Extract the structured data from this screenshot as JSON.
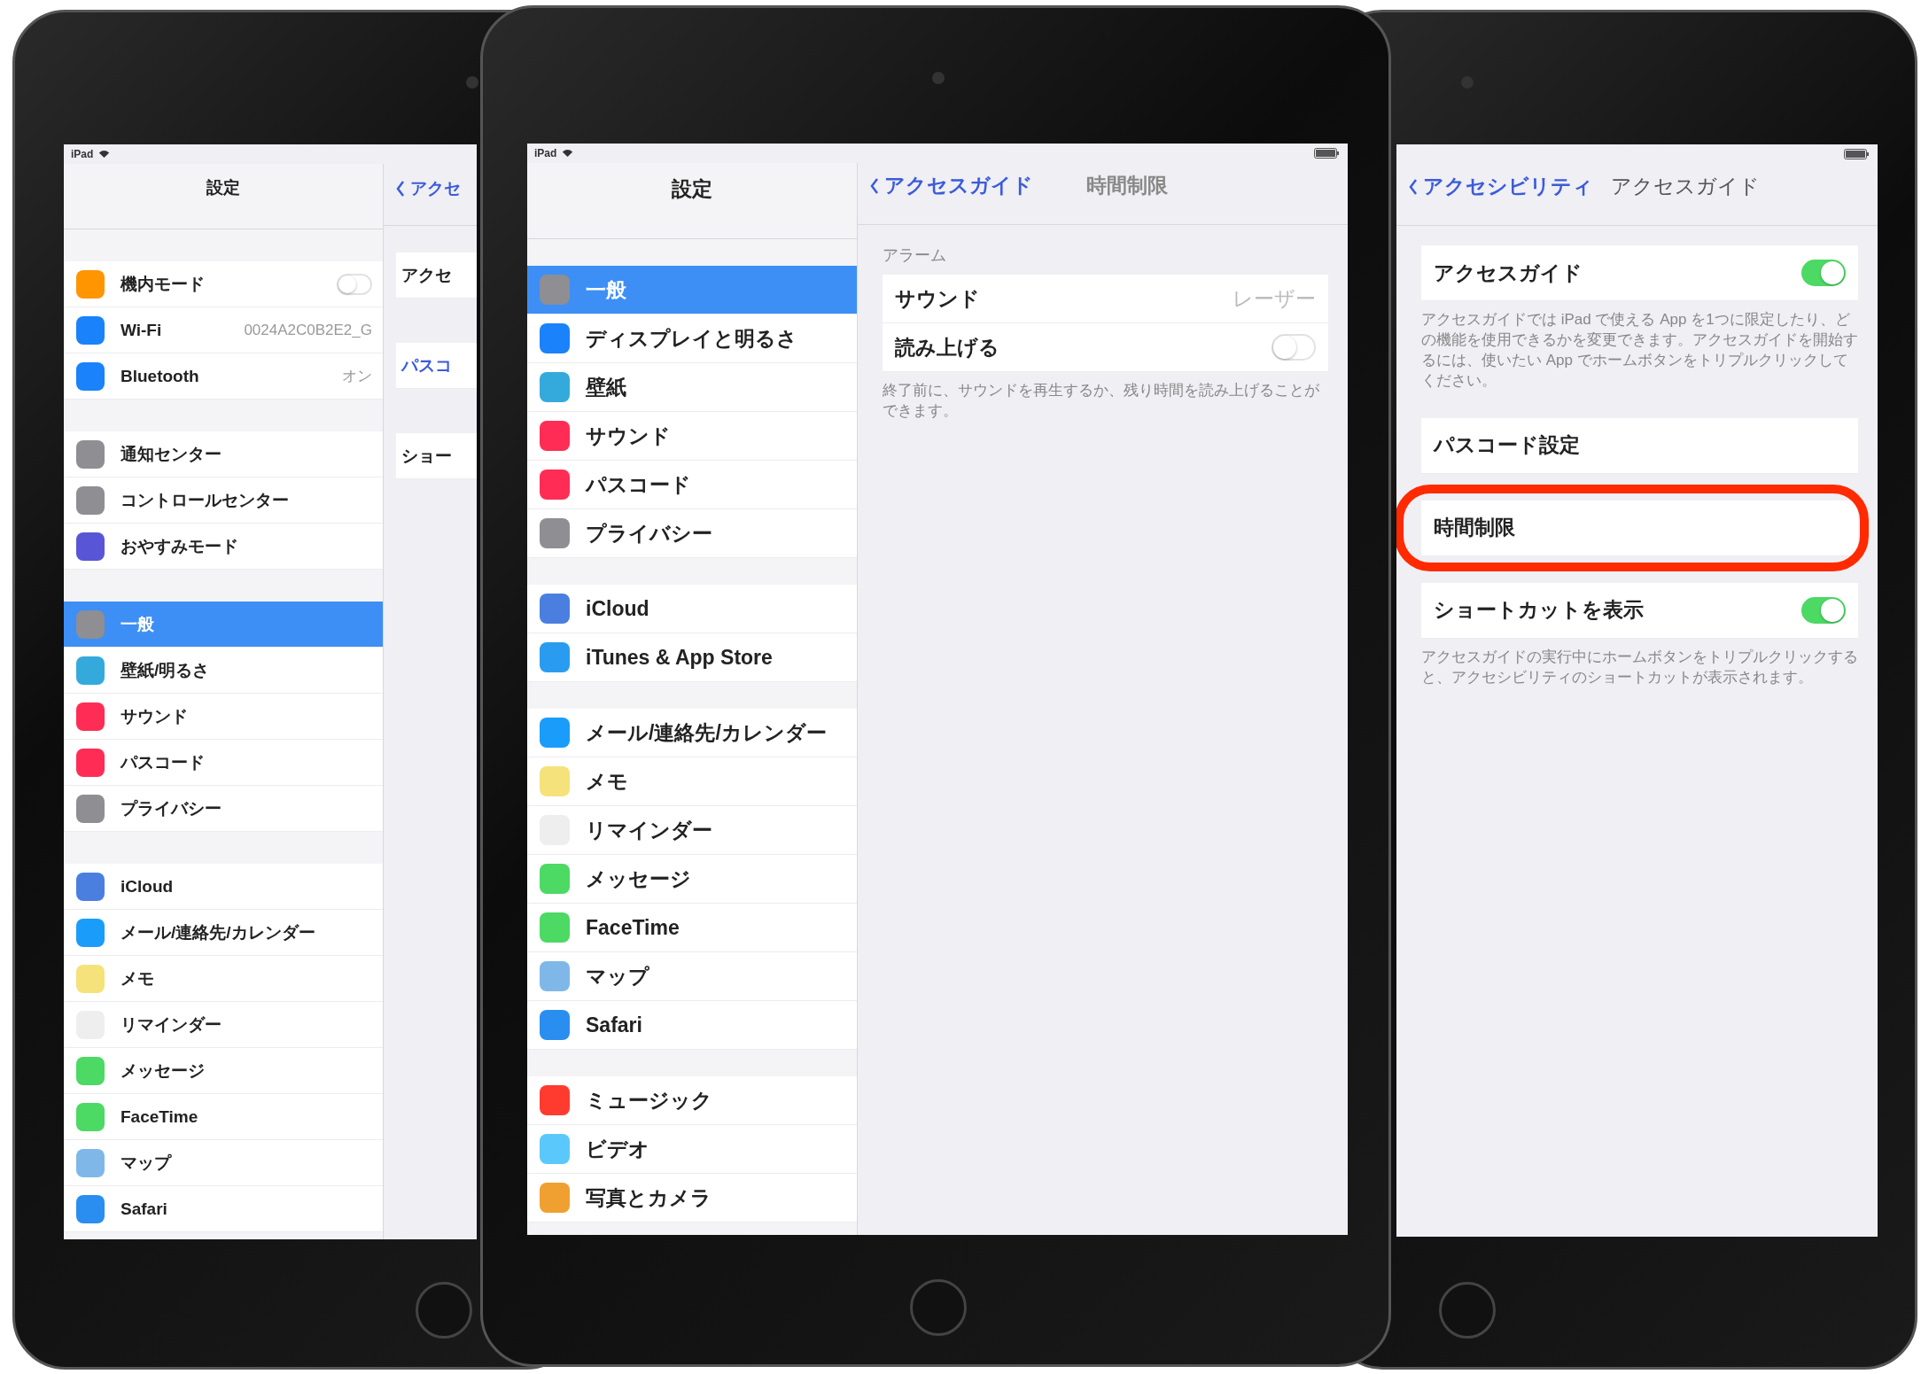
{
  "devices": [
    {
      "status": {
        "carrier": "iPad",
        "wifi": true
      },
      "sidebar": {
        "title": "設定",
        "groups": [
          [
            {
              "kind": "toggle",
              "label": "機内モード",
              "color": "#ff9500",
              "on": false,
              "selected": false
            },
            {
              "kind": "value",
              "label": "Wi-Fi",
              "value": "0024A2C0B2E2_G",
              "color": "#1a82fb",
              "selected": false
            },
            {
              "kind": "value",
              "label": "Bluetooth",
              "value": "オン",
              "color": "#1a82fb",
              "selected": false
            }
          ],
          [
            {
              "kind": "plain",
              "label": "通知センター",
              "color": "#8e8e93",
              "selected": false
            },
            {
              "kind": "plain",
              "label": "コントロールセンター",
              "color": "#8e8e93",
              "selected": false
            },
            {
              "kind": "plain",
              "label": "おやすみモード",
              "color": "#5856d6",
              "selected": false
            }
          ],
          [
            {
              "kind": "plain",
              "label": "一般",
              "color": "#8e8e93",
              "selected": true
            },
            {
              "kind": "plain",
              "label": "壁紙/明るさ",
              "color": "#34aadc",
              "selected": false
            },
            {
              "kind": "plain",
              "label": "サウンド",
              "color": "#ff2d55",
              "selected": false
            },
            {
              "kind": "plain",
              "label": "パスコード",
              "color": "#ff2d55",
              "selected": false
            },
            {
              "kind": "plain",
              "label": "プライバシー",
              "color": "#8e8e93",
              "selected": false
            }
          ],
          [
            {
              "kind": "plain",
              "label": "iCloud",
              "color": "#4a7fe0",
              "selected": false
            },
            {
              "kind": "plain",
              "label": "メール/連絡先/カレンダー",
              "color": "#1a9cfb",
              "selected": false
            },
            {
              "kind": "plain",
              "label": "メモ",
              "color": "#f6e27a",
              "selected": false
            },
            {
              "kind": "plain",
              "label": "リマインダー",
              "color": "#eeeeee",
              "selected": false
            },
            {
              "kind": "plain",
              "label": "メッセージ",
              "color": "#4cd964",
              "selected": false
            },
            {
              "kind": "plain",
              "label": "FaceTime",
              "color": "#4cd964",
              "selected": false
            },
            {
              "kind": "plain",
              "label": "マップ",
              "color": "#7fb8e8",
              "selected": false
            },
            {
              "kind": "plain",
              "label": "Safari",
              "color": "#2a8ef0",
              "selected": false
            }
          ]
        ]
      },
      "detail": {
        "back": "アクセ",
        "sections": [
          {
            "rows": [
              {
                "kind": "plain",
                "label": "アクセ"
              }
            ]
          },
          {
            "rows": [
              {
                "kind": "link",
                "label": "パスコ"
              }
            ]
          },
          {
            "rows": [
              {
                "kind": "plain",
                "label": "ショー"
              }
            ]
          }
        ]
      }
    },
    {
      "status": {
        "carrier": "iPad",
        "wifi": true,
        "battery": true
      },
      "sidebar": {
        "title": "設定",
        "groups": [
          [
            {
              "kind": "plain",
              "label": "一般",
              "color": "#8e8e93",
              "selected": true
            },
            {
              "kind": "plain",
              "label": "ディスプレイと明るさ",
              "color": "#1a82fb",
              "selected": false
            },
            {
              "kind": "plain",
              "label": "壁紙",
              "color": "#34aadc",
              "selected": false
            },
            {
              "kind": "plain",
              "label": "サウンド",
              "color": "#ff2d55",
              "selected": false
            },
            {
              "kind": "plain",
              "label": "パスコード",
              "color": "#ff2d55",
              "selected": false
            },
            {
              "kind": "plain",
              "label": "プライバシー",
              "color": "#8e8e93",
              "selected": false
            }
          ],
          [
            {
              "kind": "plain",
              "label": "iCloud",
              "color": "#4a7fe0",
              "selected": false
            },
            {
              "kind": "plain",
              "label": "iTunes & App Store",
              "color": "#2a9cf0",
              "selected": false
            }
          ],
          [
            {
              "kind": "plain",
              "label": "メール/連絡先/カレンダー",
              "color": "#1a9cfb",
              "selected": false
            },
            {
              "kind": "plain",
              "label": "メモ",
              "color": "#f6e27a",
              "selected": false
            },
            {
              "kind": "plain",
              "label": "リマインダー",
              "color": "#eeeeee",
              "selected": false
            },
            {
              "kind": "plain",
              "label": "メッセージ",
              "color": "#4cd964",
              "selected": false
            },
            {
              "kind": "plain",
              "label": "FaceTime",
              "color": "#4cd964",
              "selected": false
            },
            {
              "kind": "plain",
              "label": "マップ",
              "color": "#7fb8e8",
              "selected": false
            },
            {
              "kind": "plain",
              "label": "Safari",
              "color": "#2a8ef0",
              "selected": false
            }
          ],
          [
            {
              "kind": "plain",
              "label": "ミュージック",
              "color": "#ff3b30",
              "selected": false
            },
            {
              "kind": "plain",
              "label": "ビデオ",
              "color": "#5ac8fa",
              "selected": false
            },
            {
              "kind": "plain",
              "label": "写真とカメラ",
              "color": "#f0a030",
              "selected": false
            }
          ]
        ]
      },
      "detail": {
        "back": "アクセスガイド",
        "title": "時間制限",
        "sections": [
          {
            "header": "アラーム",
            "rows": [
              {
                "kind": "value",
                "label": "サウンド",
                "value": "レーザー"
              },
              {
                "kind": "toggle",
                "label": "読み上げる",
                "on": false
              }
            ],
            "footer": "終了前に、サウンドを再生するか、残り時間を読み上げることができます。"
          }
        ]
      }
    },
    {
      "status": {
        "battery": true
      },
      "detail": {
        "back": "アクセシビリティ",
        "title": "アクセスガイド",
        "sections": [
          {
            "rows": [
              {
                "kind": "toggle",
                "label": "アクセスガイド",
                "on": true
              }
            ],
            "footer": "アクセスガイドでは iPad で使える App を1つに限定したり、どの機能を使用できるかを変更できます。アクセスガイドを開始するには、使いたい App でホームボタンをトリプルクリックしてください。"
          },
          {
            "rows": [
              {
                "kind": "plain",
                "label": "パスコード設定"
              }
            ]
          },
          {
            "rows": [
              {
                "kind": "plain",
                "label": "時間制限",
                "highlighted": true
              }
            ]
          },
          {
            "rows": [
              {
                "kind": "toggle",
                "label": "ショートカットを表示",
                "on": true
              }
            ],
            "footer": "アクセスガイドの実行中にホームボタンをトリプルクリックすると、アクセシビリティのショートカットが表示されます。"
          }
        ]
      }
    }
  ]
}
